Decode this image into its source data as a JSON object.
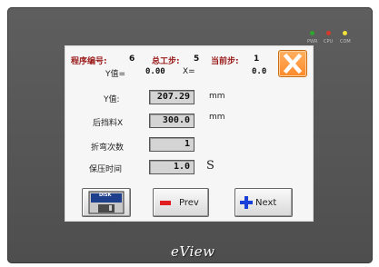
{
  "header": {
    "program_label": "程序编号:",
    "program_value": "6",
    "total_steps_label": "总工步:",
    "total_steps_value": "5",
    "current_step_label": "当前步:",
    "current_step_value": "1"
  },
  "status": {
    "y_label": "Y值=",
    "y_value": "0.00",
    "x_label": "X=",
    "x_value": "0.0"
  },
  "fields": [
    {
      "label": "Y值:",
      "value": "207.29",
      "unit": "mm"
    },
    {
      "label": "后挡料X",
      "value": "300.0",
      "unit": "mm"
    },
    {
      "label": "折弯次数",
      "value": "1",
      "unit": ""
    },
    {
      "label": "保压时间",
      "value": "1.0",
      "unit": "S"
    }
  ],
  "buttons": {
    "disk_label": "DISK",
    "prev_label": "Prev",
    "next_label": "Next"
  },
  "leds": [
    {
      "label": "PWR",
      "color": "#2fa52f"
    },
    {
      "label": "CPU",
      "color": "#d63a2a"
    },
    {
      "label": "COM",
      "color": "#f2e23a"
    }
  ],
  "brand": "eView",
  "colors": {
    "close_button": "#ff8a2a",
    "minus_icon": "#e02020",
    "plus_icon": "#1a3fd6",
    "header_text": "#9a1a1a"
  }
}
